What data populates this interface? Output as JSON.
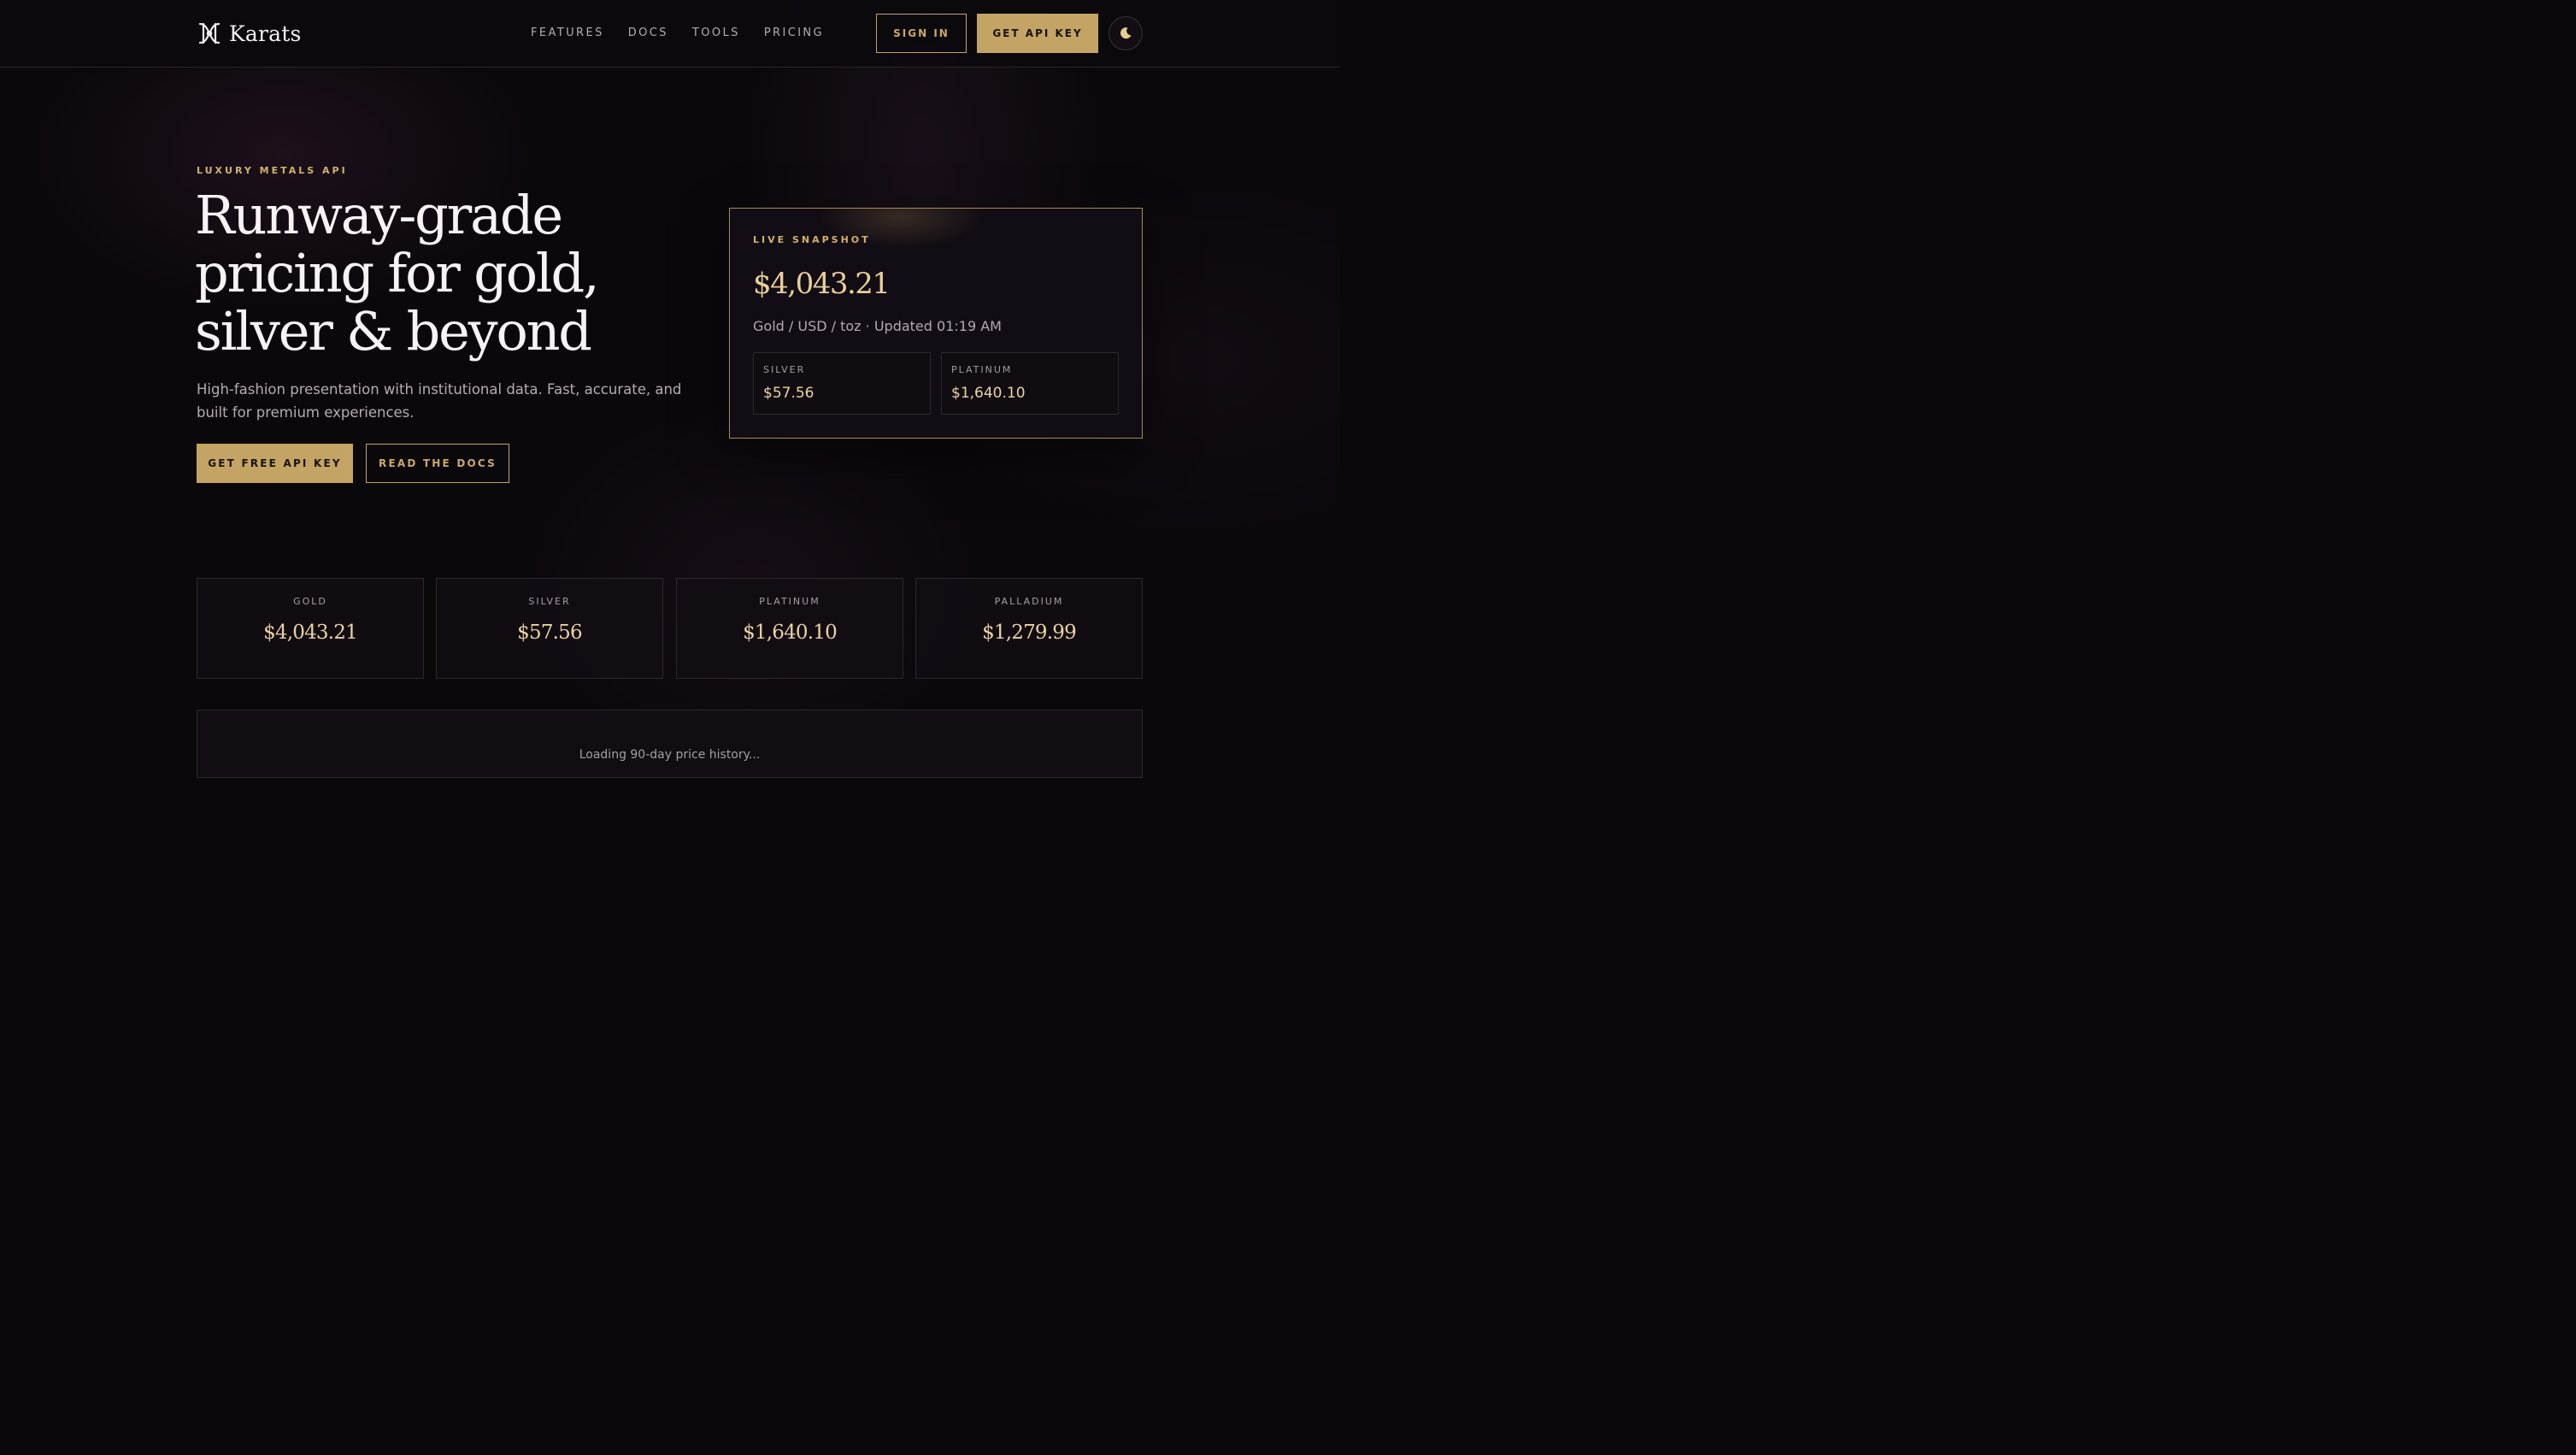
{
  "brand": {
    "name": "Karats",
    "logo_icon": "ornamental-k-monogram-icon"
  },
  "nav": {
    "links": [
      "FEATURES",
      "DOCS",
      "TOOLS",
      "PRICING"
    ],
    "sign_in": "SIGN IN",
    "get_api_key": "GET API KEY",
    "theme_icon": "moon-icon"
  },
  "hero": {
    "eyebrow": "LUXURY METALS API",
    "title_lines": [
      "Runway-grade",
      "pricing for gold,",
      "silver & beyond"
    ],
    "subtitle": "High-fashion presentation with institutional data. Fast, accurate, and built for premium experiences.",
    "cta_primary": "GET FREE API KEY",
    "cta_secondary": "READ THE DOCS"
  },
  "snapshot": {
    "label": "LIVE SNAPSHOT",
    "price": "$4,043.21",
    "meta": "Gold / USD / toz · Updated 01:19 AM",
    "items": [
      {
        "label": "SILVER",
        "value": "$57.56"
      },
      {
        "label": "PLATINUM",
        "value": "$1,640.10"
      }
    ]
  },
  "prices": [
    {
      "label": "GOLD",
      "value": "$4,043.21"
    },
    {
      "label": "SILVER",
      "value": "$57.56"
    },
    {
      "label": "PLATINUM",
      "value": "$1,640.10"
    },
    {
      "label": "PALLADIUM",
      "value": "$1,279.99"
    }
  ],
  "history": {
    "status": "Loading 90-day price history..."
  },
  "colors": {
    "background": "#0b080c",
    "gold_accent": "#c4a465",
    "gold_text": "#ecd3a0",
    "muted_text": "#b5acb3"
  }
}
